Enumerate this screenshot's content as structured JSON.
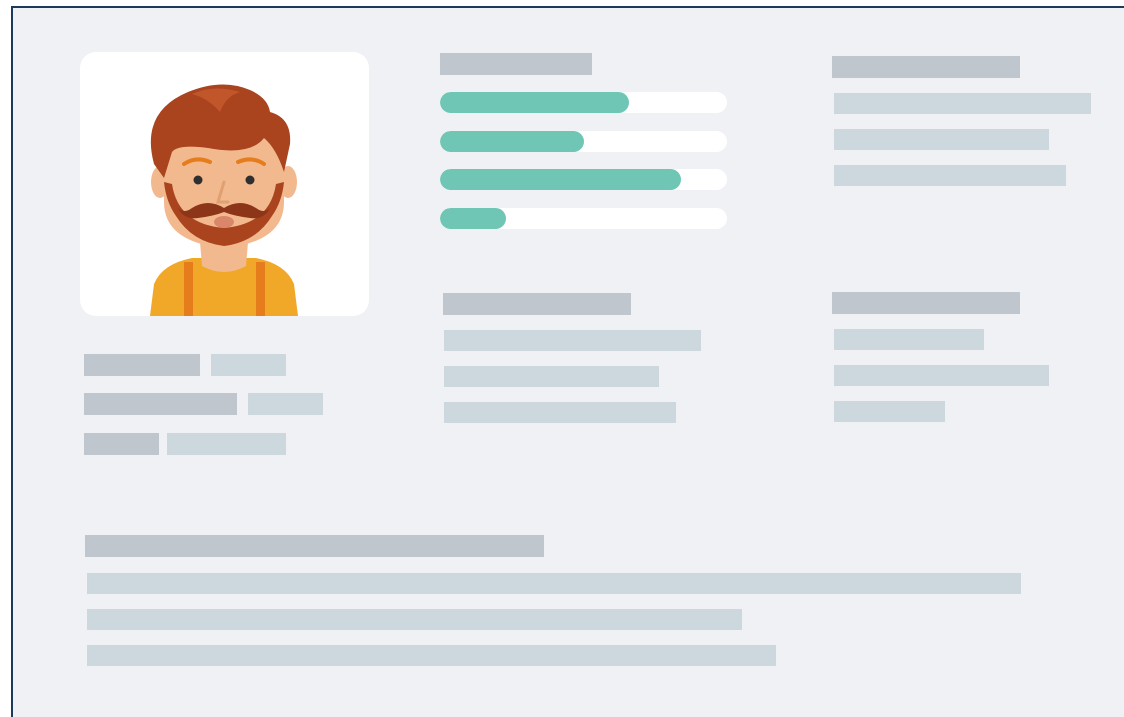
{
  "profile": {
    "avatar_icon": "bearded-man-avatar-icon",
    "colors": {
      "hair": "#a9441f",
      "skin": "#f3b98e",
      "shirt": "#f1a828",
      "suspenders": "#e57d1d"
    }
  },
  "skills": {
    "fill_color": "#6fc6b5",
    "track_color": "#ffffff",
    "levels": [
      0.66,
      0.5,
      0.84,
      0.23
    ]
  },
  "colors": {
    "background": "#eff1f5",
    "heading_placeholder": "#bfc6cd",
    "line_placeholder": "#cdd7de",
    "frame_border": "#1b3a5c"
  }
}
